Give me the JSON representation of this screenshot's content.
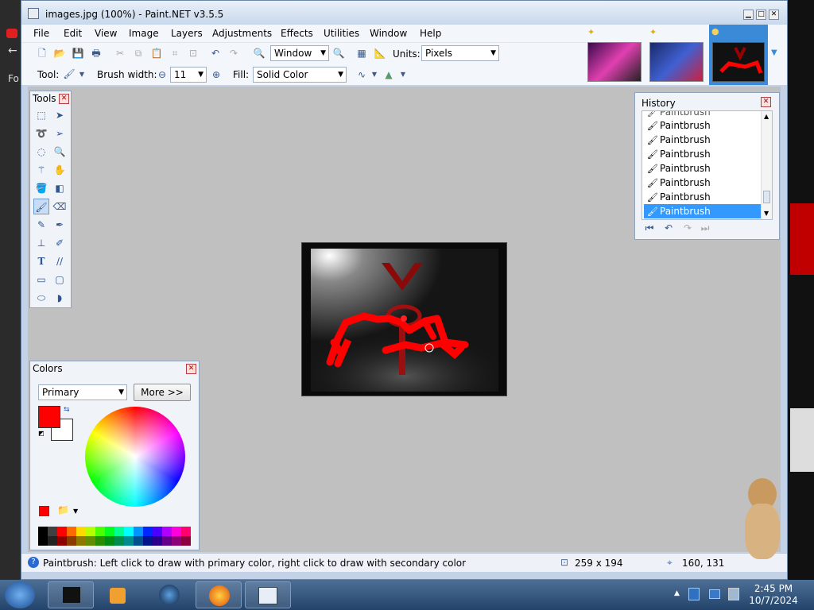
{
  "window": {
    "title": "images.jpg (100%) - Paint.NET v3.5.5"
  },
  "menu": [
    "File",
    "Edit",
    "View",
    "Image",
    "Layers",
    "Adjustments",
    "Effects",
    "Utilities",
    "Window",
    "Help"
  ],
  "toolbar": {
    "zoom_value": "Window",
    "units_label": "Units:",
    "units_value": "Pixels",
    "tool_label": "Tool:",
    "brush_width_label": "Brush width:",
    "brush_width_value": "11",
    "fill_label": "Fill:",
    "fill_value": "Solid Color"
  },
  "tools_panel": {
    "title": "Tools"
  },
  "history_panel": {
    "title": "History",
    "items": [
      "Paintbrush",
      "Paintbrush",
      "Paintbrush",
      "Paintbrush",
      "Paintbrush",
      "Paintbrush",
      "Paintbrush",
      "Paintbrush"
    ],
    "selected_index": 7
  },
  "colors_panel": {
    "title": "Colors",
    "mode": "Primary",
    "more_button": "More >>",
    "primary_color": "#ff0000",
    "secondary_color": "#ffffff",
    "palette": [
      "#000000",
      "#404040",
      "#ff0000",
      "#ff6a00",
      "#ffd800",
      "#b6ff00",
      "#4cff00",
      "#00ff21",
      "#00ff90",
      "#00ffff",
      "#0094ff",
      "#0026ff",
      "#4800ff",
      "#b200ff",
      "#ff00dc",
      "#ff006e"
    ]
  },
  "status": {
    "message": "Paintbrush: Left click to draw with primary color, right click to draw with secondary color",
    "image_size": "259 x 194",
    "cursor_position": "160, 131"
  },
  "taskbar": {
    "time": "2:45 PM",
    "date": "10/7/2024"
  },
  "background": {
    "left_text": "Fo"
  }
}
